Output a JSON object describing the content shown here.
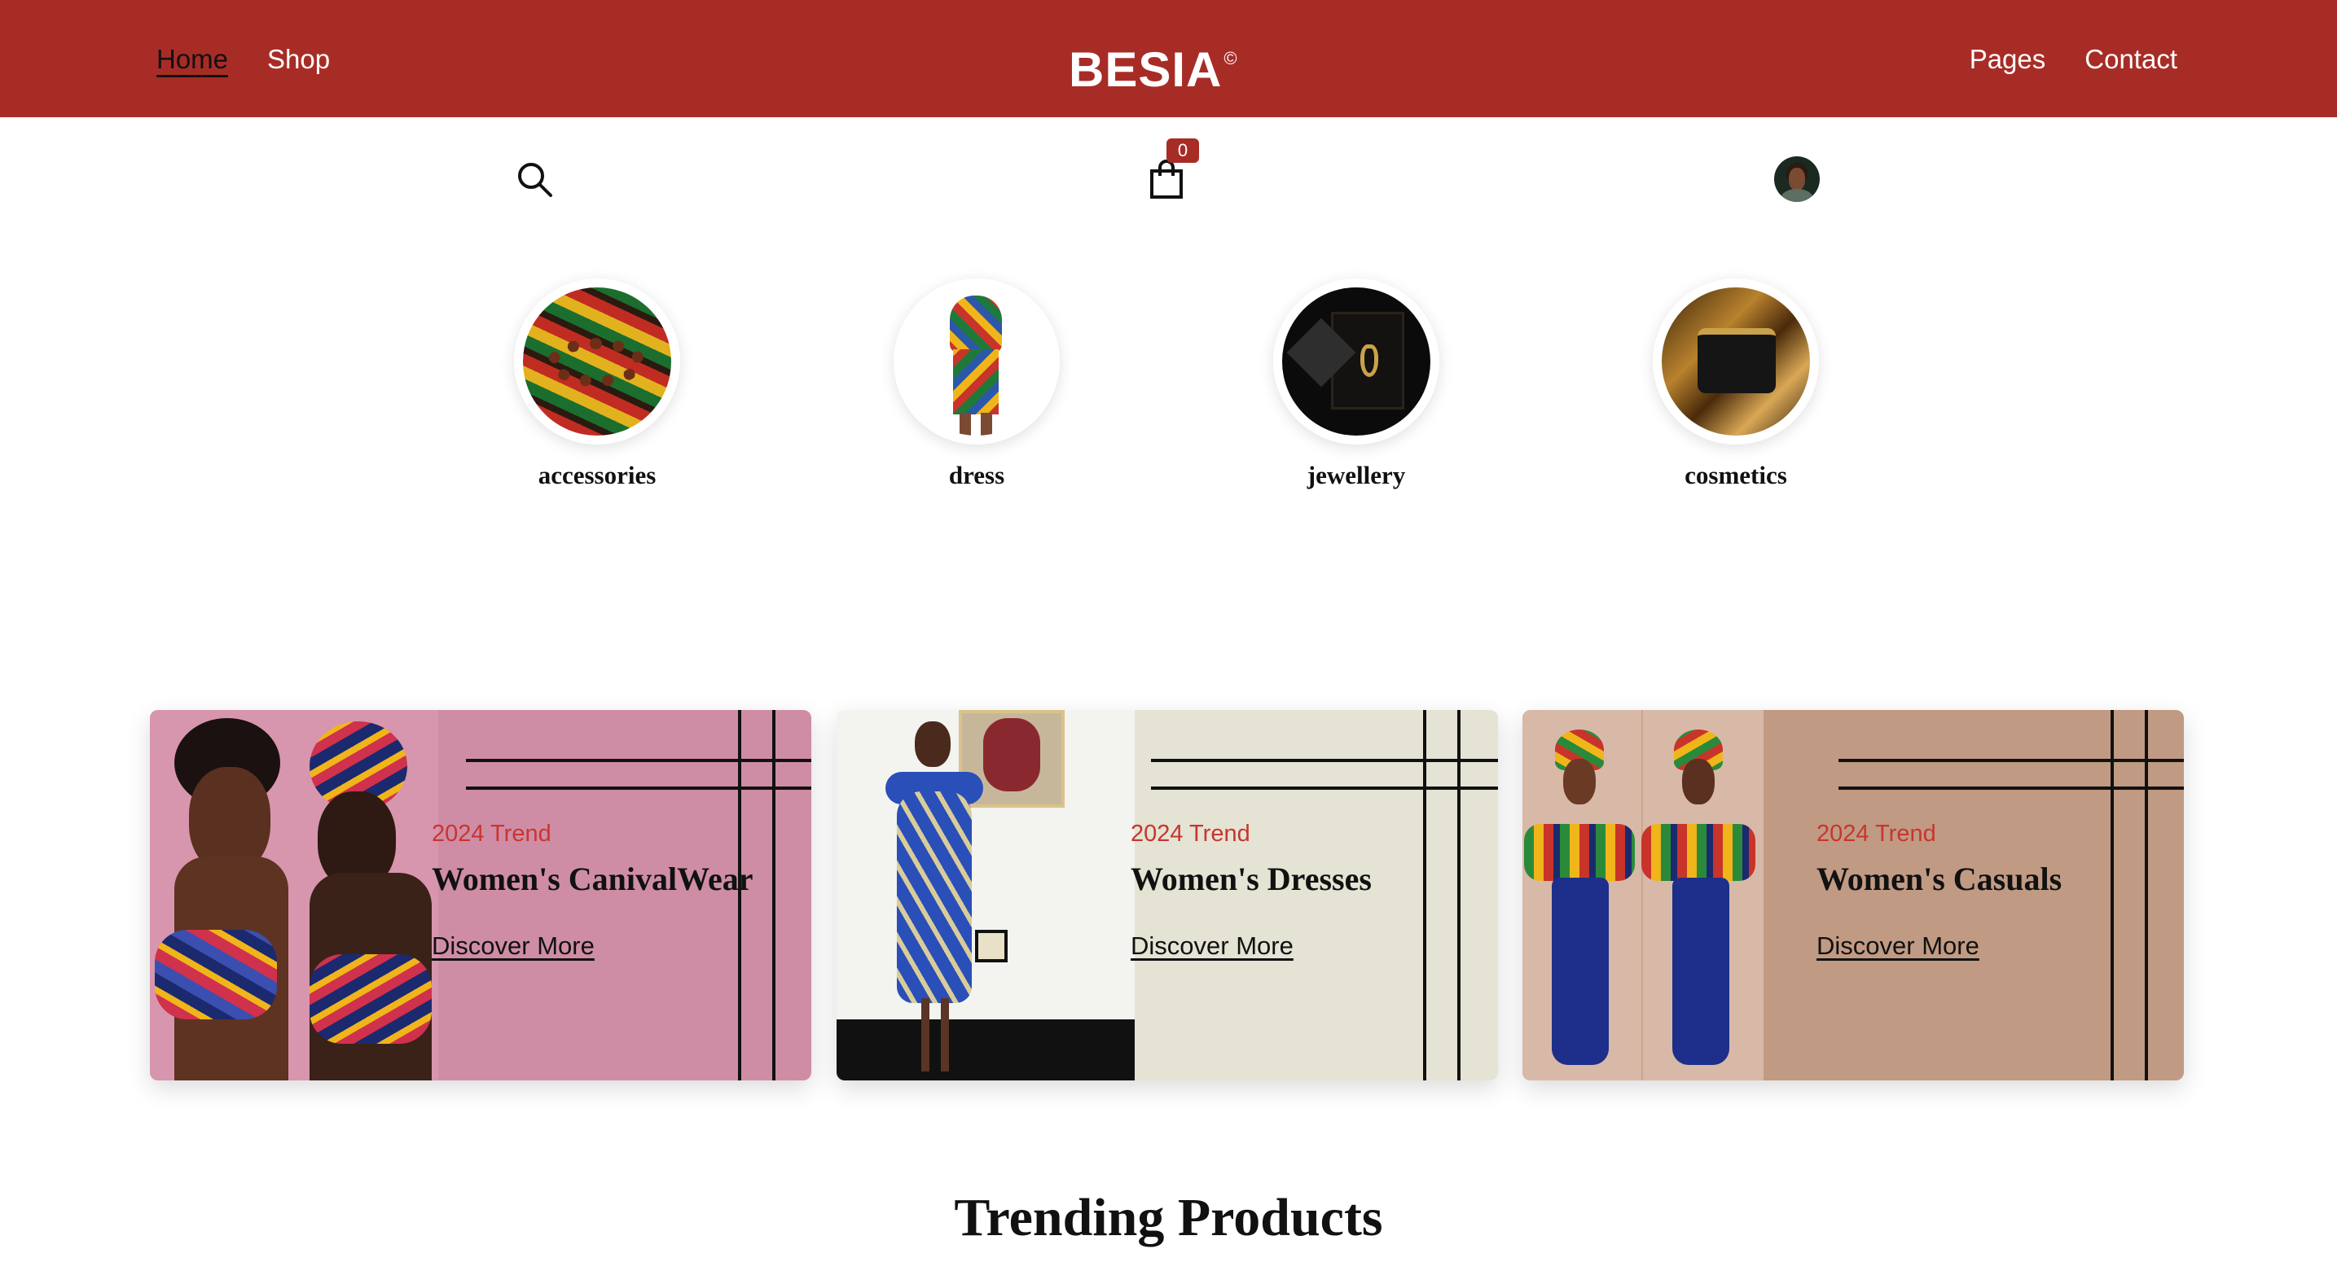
{
  "header": {
    "nav_left": [
      "Home",
      "Shop"
    ],
    "nav_right": [
      "Pages",
      "Contact"
    ],
    "brand": "BESIA",
    "brand_mark": "©",
    "background_color": "#a82c26"
  },
  "toolbar": {
    "search_icon": "search-icon",
    "cart_icon": "shopping-bag-icon",
    "cart_count": "0",
    "avatar": "user-avatar"
  },
  "categories": [
    {
      "label": "accessories"
    },
    {
      "label": "dress"
    },
    {
      "label": "jewellery"
    },
    {
      "label": "cosmetics"
    }
  ],
  "banners": [
    {
      "tag": "2024 Trend",
      "title": "Women's CanivalWear",
      "link": "Discover More",
      "bg": "#cf8da5"
    },
    {
      "tag": "2024 Trend",
      "title": "Women's Dresses",
      "link": "Discover More",
      "bg": "#e4e3d4"
    },
    {
      "tag": "2024 Trend",
      "title": "Women's Casuals",
      "link": "Discover More",
      "bg": "#c09a83"
    }
  ],
  "trending": {
    "title": "Trending Products"
  }
}
